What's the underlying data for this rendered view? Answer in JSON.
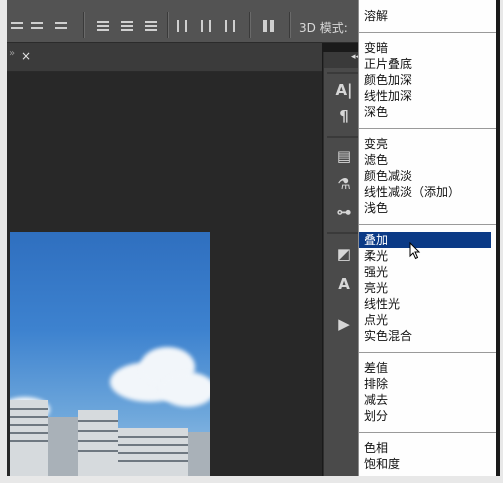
{
  "options_bar": {
    "mode_3d_label": "3D 模式:"
  },
  "document_tab": {
    "close_glyph": "×",
    "overflow_glyph": "»"
  },
  "panel_strip": {
    "collapse_glyph": "◂◂",
    "icons": [
      "character-icon",
      "paragraph-icon",
      "layer-comps-icon",
      "tool-presets-icon",
      "adjust-icon",
      "clone-source-icon",
      "character-styles-icon",
      "play-icon"
    ]
  },
  "blend_menu": {
    "groups": [
      [
        "溶解"
      ],
      [
        "变暗",
        "正片叠底",
        "颜色加深",
        "线性加深",
        "深色"
      ],
      [
        "变亮",
        "滤色",
        "颜色减淡",
        "线性减淡（添加）",
        "浅色"
      ],
      [
        "叠加",
        "柔光",
        "强光",
        "亮光",
        "线性光",
        "点光",
        "实色混合"
      ],
      [
        "差值",
        "排除",
        "减去",
        "划分"
      ],
      [
        "色相",
        "饱和度"
      ]
    ],
    "selected": "叠加",
    "selected_color": "#0b3a86"
  }
}
